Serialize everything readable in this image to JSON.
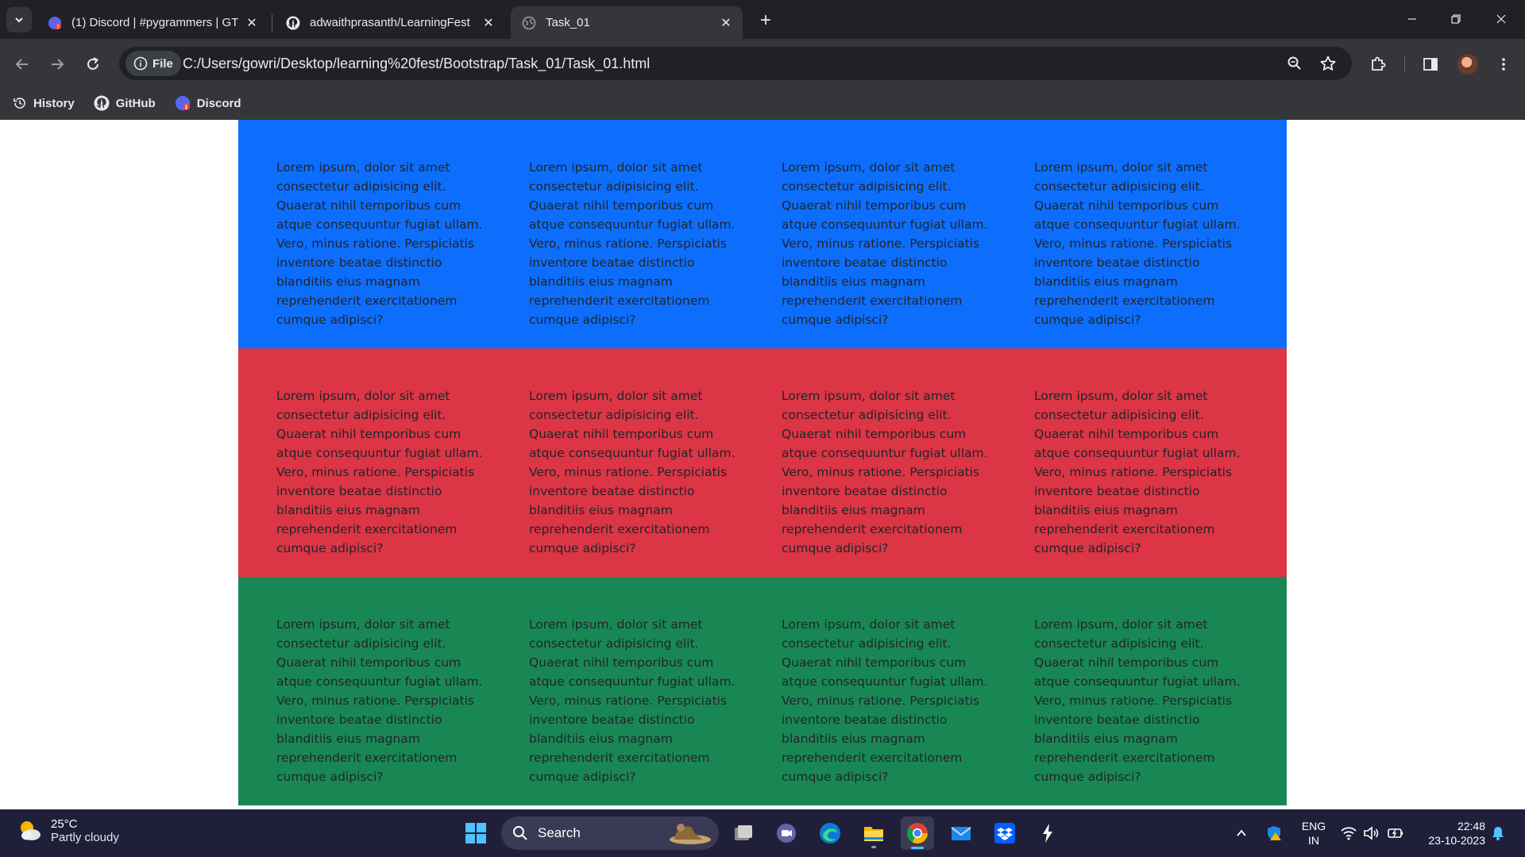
{
  "tabs": [
    {
      "title": "(1) Discord | #pygrammers | GT",
      "favicon": "discord-icon"
    },
    {
      "title": "adwaithprasanth/LearningFest",
      "favicon": "github-icon"
    },
    {
      "title": "Task_01",
      "favicon": "globe-icon",
      "active": true
    }
  ],
  "omnibox": {
    "chip_label": "File",
    "url": "C:/Users/gowri/Desktop/learning%20fest/Bootstrap/Task_01/Task_01.html"
  },
  "bookmarks": [
    {
      "label": "History",
      "icon": "history-icon"
    },
    {
      "label": "GitHub",
      "icon": "github-icon"
    },
    {
      "label": "Discord",
      "icon": "discord-icon"
    }
  ],
  "page": {
    "lorem": "Lorem ipsum, dolor sit amet consectetur adipisicing elit. Quaerat nihil temporibus cum atque consequuntur fugiat ullam. Vero, minus ratione. Perspiciatis inventore beatae distinctio blanditiis eius magnam reprehenderit exercitationem cumque adipisci?",
    "bands": [
      {
        "color": "#0d6efd",
        "name": "blue"
      },
      {
        "color": "#dc3545",
        "name": "red"
      },
      {
        "color": "#198754",
        "name": "green"
      }
    ]
  },
  "taskbar": {
    "weather_temp": "25°C",
    "weather_desc": "Partly cloudy",
    "search_label": "Search",
    "lang_top": "ENG",
    "lang_bottom": "IN",
    "time": "22:48",
    "date": "23-10-2023"
  }
}
